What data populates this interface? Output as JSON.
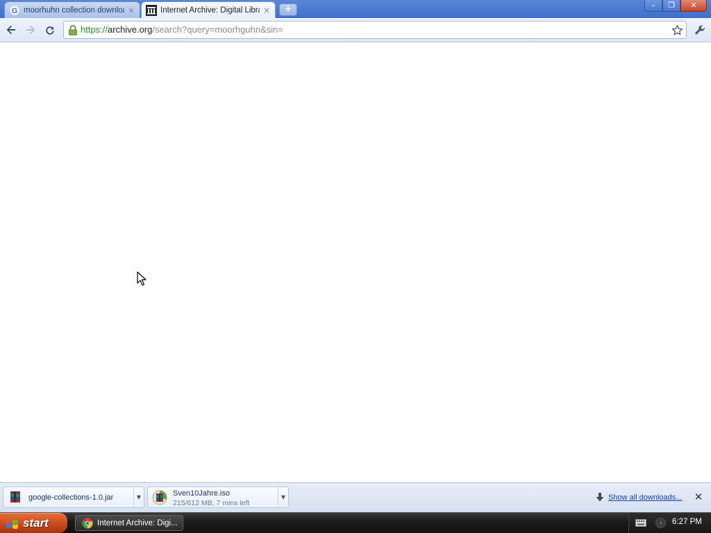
{
  "tabs": [
    {
      "title": "moorhuhn collection download",
      "favicon": "google-icon",
      "active": false
    },
    {
      "title": "Internet Archive: Digital Librar",
      "favicon": "archive-icon",
      "active": true
    }
  ],
  "new_tab_label": "+",
  "window_controls": {
    "minimize": "–",
    "maximize": "❐",
    "close": "✕"
  },
  "omnibox": {
    "scheme": "https://",
    "host": "archive.org",
    "path": "/search?query=moorhguhn&sin="
  },
  "downloads": [
    {
      "name": "google-collections-1.0.jar",
      "status": "",
      "icon": "archive-file-icon"
    },
    {
      "name": "Sven10Jahre.iso",
      "status": "215/612 MB, 7 mins left",
      "icon": "progress-icon"
    }
  ],
  "show_all_downloads": "Show all downloads...",
  "taskbar": {
    "start_label": "start",
    "task_label": "Internet Archive: Digi...",
    "clock": "6:27 PM"
  },
  "colors": {
    "titlebar": "#4a78cf",
    "secure_scheme": "#2b8a2b",
    "start_button": "#c8461a"
  }
}
